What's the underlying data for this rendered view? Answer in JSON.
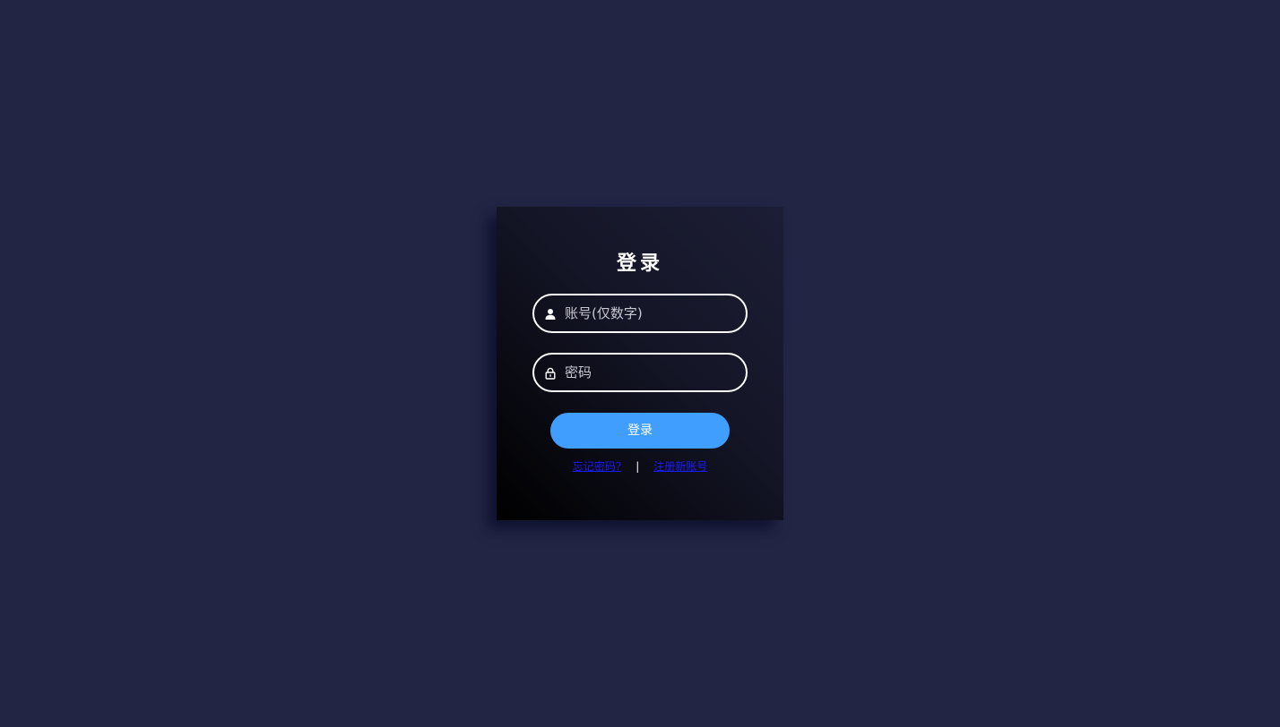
{
  "login": {
    "title": "登录",
    "username": {
      "placeholder": "账号(仅数字)",
      "value": "",
      "icon": "user-icon"
    },
    "password": {
      "placeholder": "密码",
      "value": "",
      "icon": "lock-icon"
    },
    "submit_label": "登录",
    "forgot_password_label": "忘记密码?",
    "separator": "|",
    "register_label": "注册新账号"
  },
  "colors": {
    "page_background": "#232545",
    "button": "#409eff",
    "link": "#1a1aff",
    "field_border": "#ffffff"
  }
}
